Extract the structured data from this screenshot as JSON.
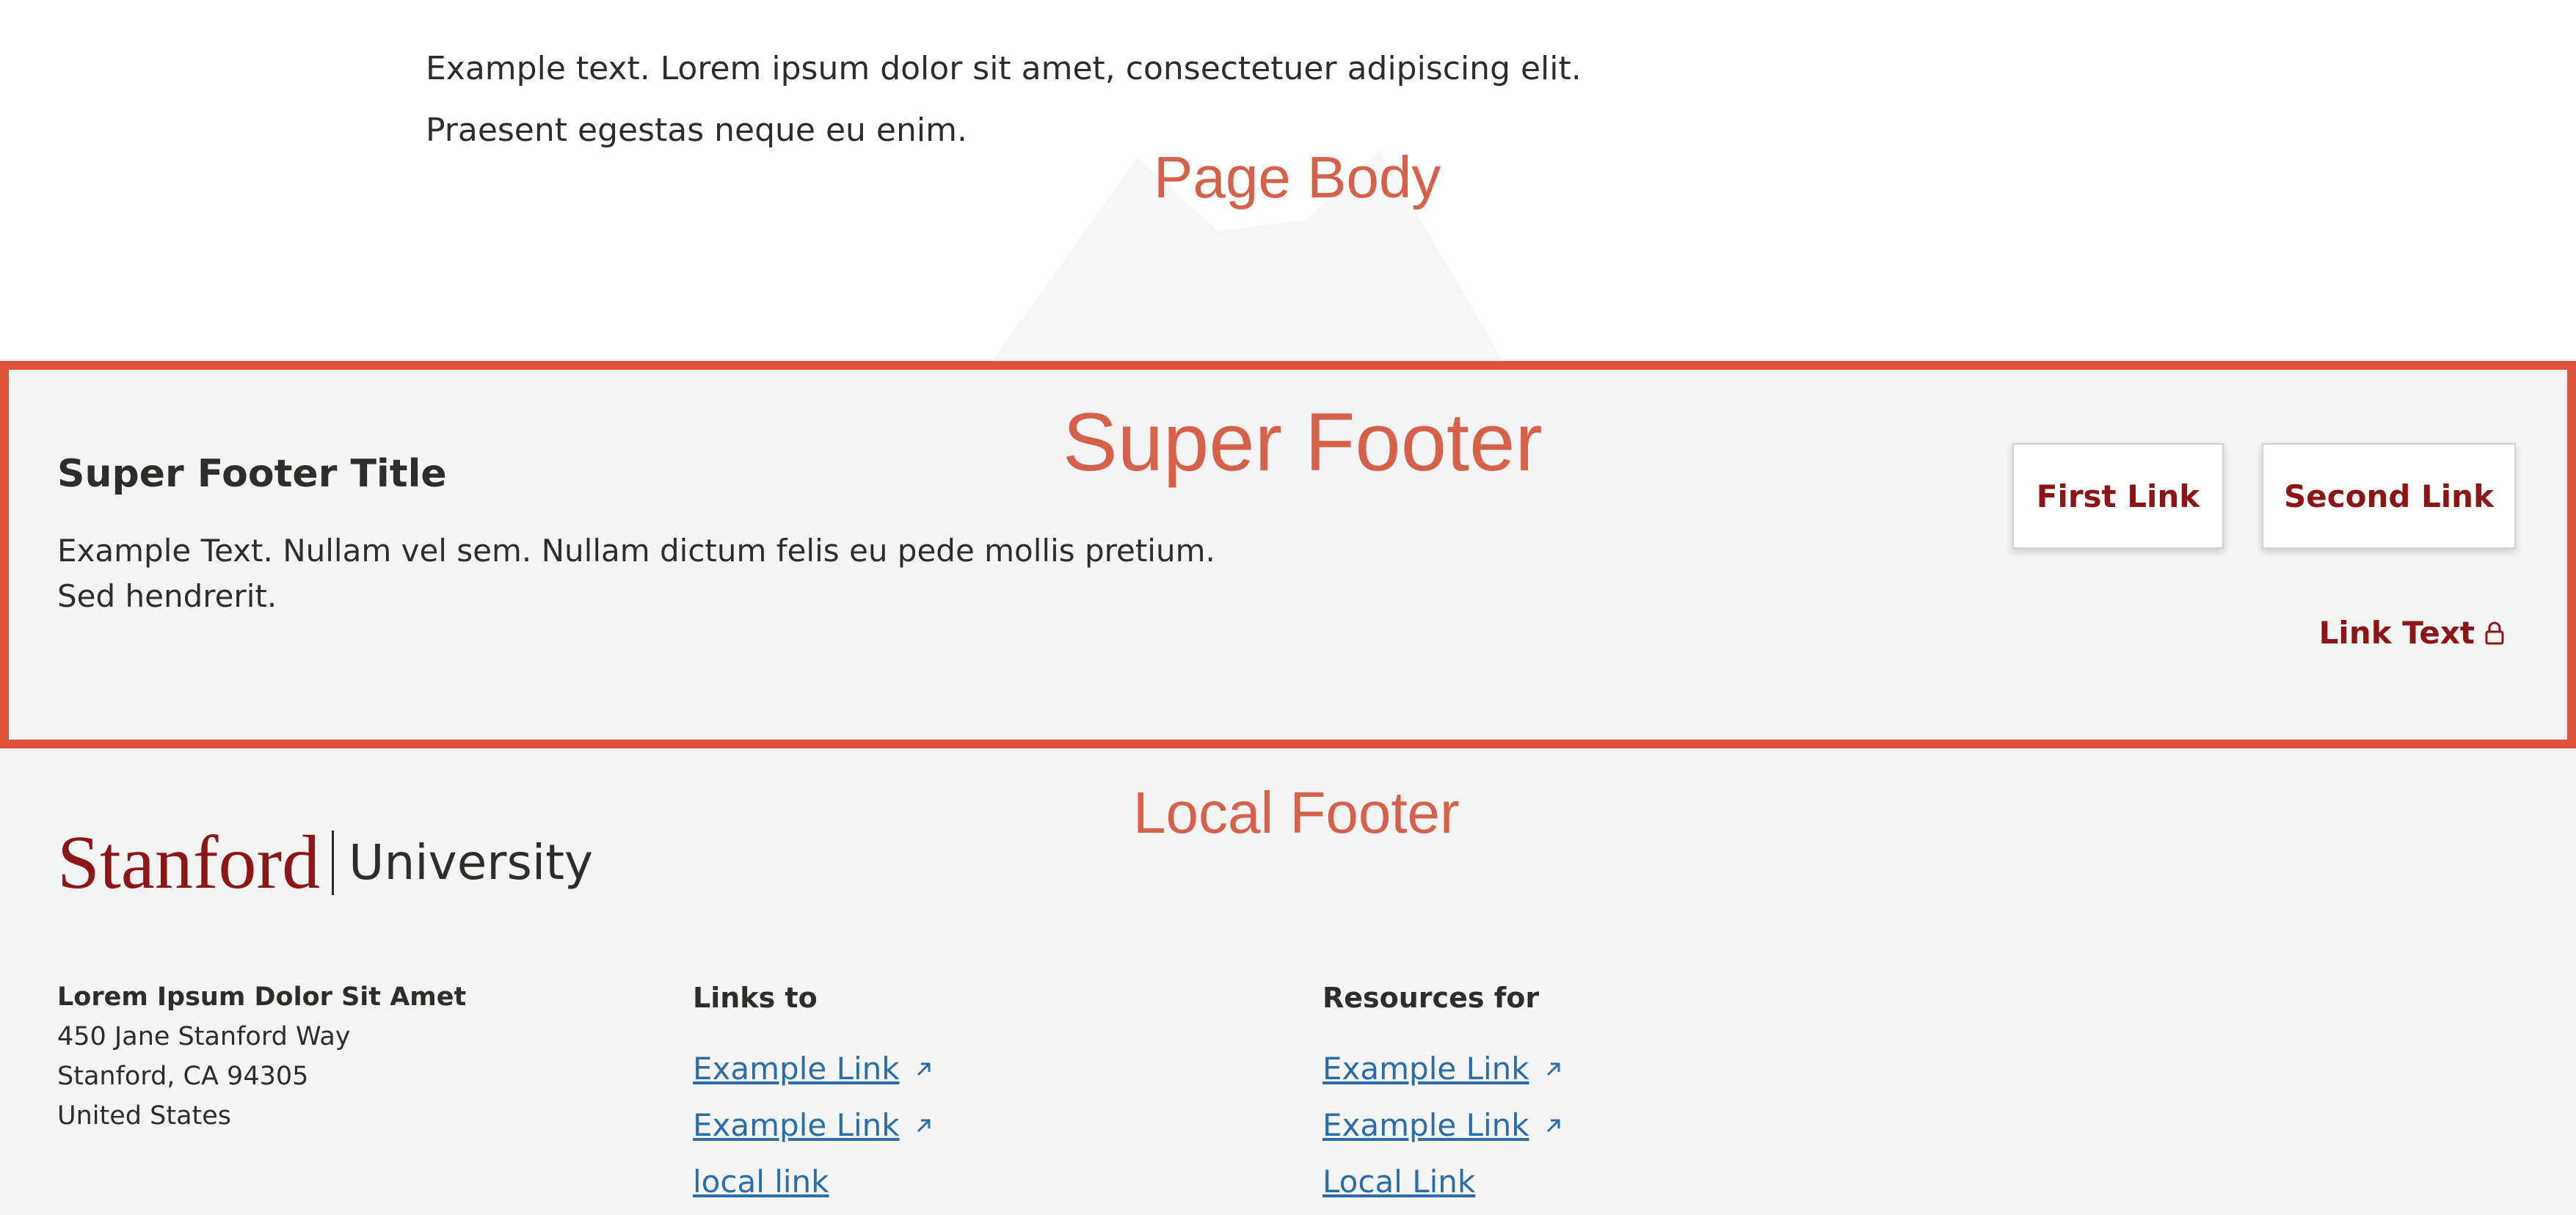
{
  "page_body": {
    "text": "Example text. Lorem ipsum dolor sit amet, consectetuer adipiscing elit. Praesent egestas neque eu enim.",
    "annotation": "Page Body"
  },
  "super_footer": {
    "annotation": "Super Footer",
    "title": "Super Footer Title",
    "text": "Example Text. Nullam vel sem. Nullam dictum felis eu pede mollis pretium. Sed hendrerit.",
    "first_button": "First Link",
    "second_button": "Second Link",
    "link_text": "Link Text",
    "link_icon": "lock-icon"
  },
  "local_footer": {
    "annotation": "Local Footer",
    "logo": {
      "stanford": "Stanford",
      "university": "University"
    },
    "address": {
      "name": "Lorem Ipsum Dolor Sit Amet",
      "street": "450 Jane Stanford Way",
      "city": "Stanford, CA 94305",
      "country": "United States"
    },
    "columns": [
      {
        "heading": "Links to",
        "links": [
          {
            "label": "Example Link",
            "external": true
          },
          {
            "label": "Example Link",
            "external": true
          },
          {
            "label": "local link",
            "external": false
          }
        ]
      },
      {
        "heading": "Resources for",
        "links": [
          {
            "label": "Example Link",
            "external": true
          },
          {
            "label": "Example Link",
            "external": true
          },
          {
            "label": "Local Link",
            "external": false
          }
        ]
      }
    ]
  },
  "colors": {
    "annotation_red": "#e0523b",
    "cardinal": "#8c1515",
    "link_blue": "#2a6dab",
    "footer_gray": "#f4f4f4"
  }
}
